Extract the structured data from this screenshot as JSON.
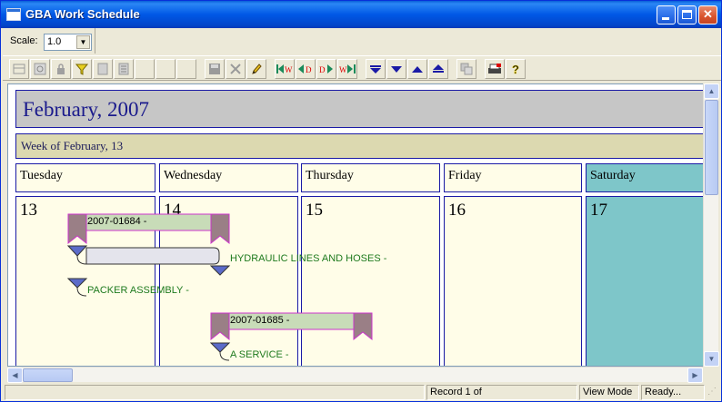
{
  "window": {
    "title": "GBA Work Schedule"
  },
  "scale": {
    "label": "Scale:",
    "value": "1.0"
  },
  "toolbar": {
    "icons": [
      "grid-icon",
      "zoom-icon",
      "lock-icon",
      "filter-icon",
      "document-icon",
      "list-icon",
      "blank",
      "blank",
      "blank",
      "save-icon",
      "delete-icon",
      "edit-pencil-icon",
      "first-week-icon",
      "prev-day-icon",
      "next-day-icon",
      "last-week-icon",
      "scroll-down-icon",
      "expand-down-icon",
      "collapse-up-icon",
      "scroll-top-icon",
      "copy-icon",
      "print-icon",
      "help-icon"
    ],
    "nav_letters": {
      "week": "W",
      "day": "D"
    }
  },
  "calendar": {
    "month": "February, 2007",
    "week": "Week of February, 13",
    "days": [
      {
        "name": "Tuesday",
        "number": "13"
      },
      {
        "name": "Wednesday",
        "number": "14"
      },
      {
        "name": "Thursday",
        "number": "15"
      },
      {
        "name": "Friday",
        "number": "16"
      },
      {
        "name": "Saturday",
        "number": "17"
      }
    ],
    "jobs": [
      {
        "label": "2007-01684 -"
      },
      {
        "label": "2007-01685 -"
      }
    ],
    "tasks": [
      {
        "label": "HYDRAULIC LINES AND HOSES -"
      },
      {
        "label": "PACKER ASSEMBLY -"
      },
      {
        "label": "A SERVICE -"
      }
    ],
    "colors": {
      "job_bar": "#c8dcb8",
      "job_border": "#cc33cc",
      "task_marker": "#5b6bc9",
      "saturday": "#7ec6c9",
      "cell": "#fffde8"
    }
  },
  "status": {
    "record": "Record 1 of",
    "mode": "View Mode",
    "state": "Ready..."
  }
}
